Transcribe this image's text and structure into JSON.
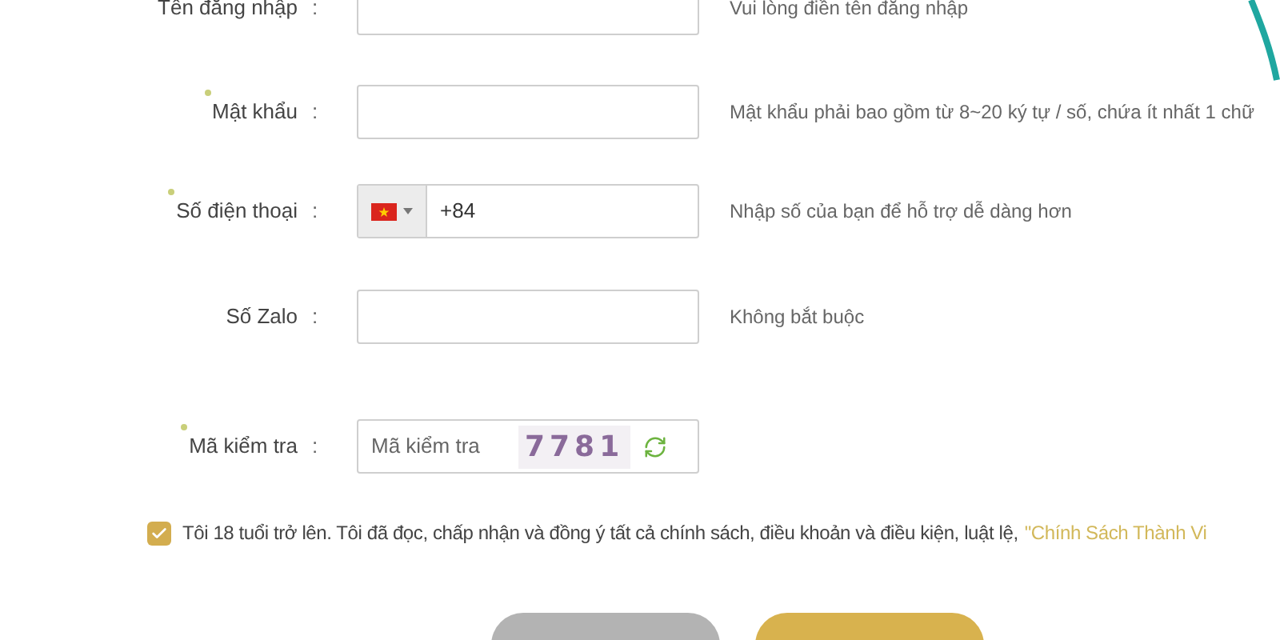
{
  "fields": [
    {
      "kind": "text",
      "label": "Tên đăng nhập",
      "required": false,
      "hint": "Vui lòng điền tên đăng nhập"
    },
    {
      "kind": "password",
      "label": "Mật khẩu",
      "required": true,
      "hint": "Mật khẩu phải bao gồm từ 8~20 ký tự / số, chứa ít nhất 1 chữ"
    },
    {
      "kind": "phone",
      "label": "Số điện thoại",
      "required": true,
      "value": "+84",
      "hint": "Nhập số của bạn để hỗ trợ dễ dàng hơn"
    },
    {
      "kind": "text",
      "label": "Số Zalo",
      "required": false,
      "hint": "Không bắt buộc"
    },
    {
      "kind": "captcha",
      "label": "Mã kiểm tra",
      "required": true,
      "placeholder": "Mã kiểm tra",
      "captcha": "7781"
    }
  ],
  "separator": ":",
  "agreement": {
    "checked": true,
    "text": "Tôi 18 tuổi trở lên. Tôi đã đọc, chấp nhận và đồng ý tất cả chính sách, điều khoản và điều kiện, luật lệ,",
    "link": "\"Chính Sách Thành Vi"
  },
  "buttons": [
    {
      "kind": "secondary"
    },
    {
      "kind": "primary"
    }
  ]
}
